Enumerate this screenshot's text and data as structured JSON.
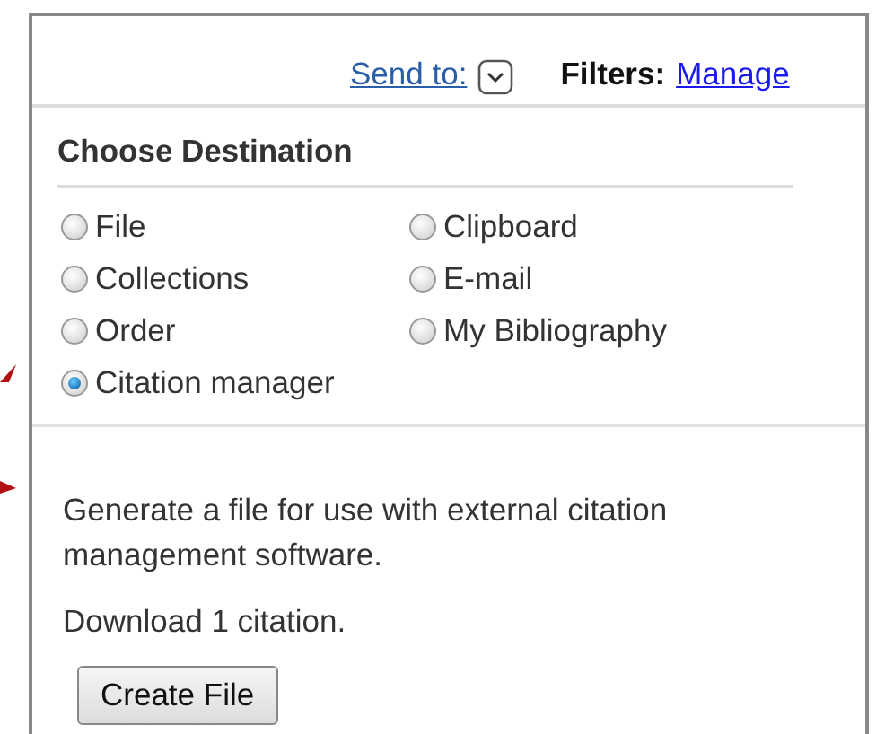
{
  "toolbar": {
    "send_to": "Send to:",
    "filters_label": "Filters:",
    "filters_link": "Manage"
  },
  "destination": {
    "title": "Choose Destination",
    "options": [
      {
        "label": "File",
        "selected": false
      },
      {
        "label": "Clipboard",
        "selected": false
      },
      {
        "label": "Collections",
        "selected": false
      },
      {
        "label": "E-mail",
        "selected": false
      },
      {
        "label": "Order",
        "selected": false
      },
      {
        "label": "My Bibliography",
        "selected": false
      },
      {
        "label": "Citation manager",
        "selected": true
      }
    ]
  },
  "details": {
    "description": "Generate a file for use with external citation management software.",
    "count": "Download 1 citation.",
    "button": "Create File"
  }
}
